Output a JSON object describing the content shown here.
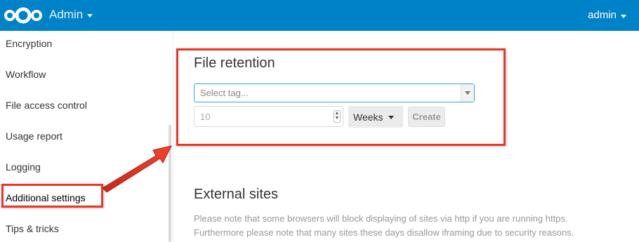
{
  "header": {
    "app_name": "Admin",
    "user": "admin",
    "bg_color": "#0082c9"
  },
  "sidebar": {
    "items": [
      {
        "label": "Encryption"
      },
      {
        "label": "Workflow"
      },
      {
        "label": "File access control"
      },
      {
        "label": "Usage report"
      },
      {
        "label": "Logging"
      },
      {
        "label": "Additional settings"
      },
      {
        "label": "Tips & tricks"
      }
    ],
    "active": "Additional settings"
  },
  "file_retention": {
    "title": "File retention",
    "tag_placeholder": "Select tag...",
    "amount_value": "10",
    "unit": "Weeks",
    "create_label": "Create"
  },
  "external_sites": {
    "title": "External sites",
    "note_line1": "Please note that some browsers will block displaying of sites via http if you are running https.",
    "note_line2": "Furthermore please note that many sites these days disallow iframing due to security reasons."
  },
  "annotation": {
    "highlight_color": "#e8372a"
  }
}
